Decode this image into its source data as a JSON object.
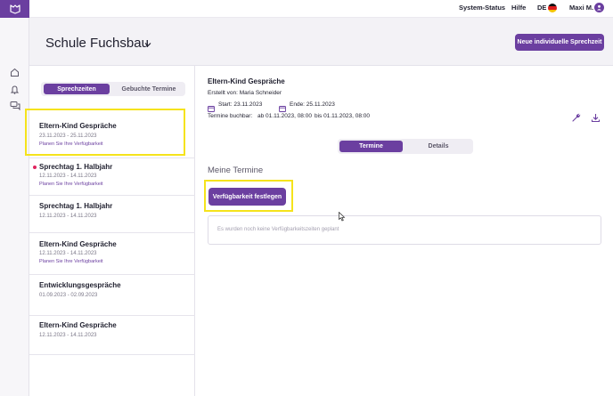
{
  "topbar": {
    "system_status": "System-Status",
    "help": "Hilfe",
    "language": "DE",
    "user": "Maxi M."
  },
  "header": {
    "title": "Schule Fuchsbau",
    "new_button": "Neue individuelle Sprechzeit"
  },
  "sidebar_tabs": {
    "active": "Sprechzeiten",
    "inactive": "Gebuchte Termine"
  },
  "list": [
    {
      "title": "Eltern-Kind Gespräche",
      "date": "23.11.2023 - 25.11.2023",
      "sub": "Planen Sie Ihre Verfügbarkeit"
    },
    {
      "title": "Sprechtag 1. Halbjahr",
      "date": "12.11.2023 - 14.11.2023",
      "sub": "Planen Sie Ihre Verfügbarkeit"
    },
    {
      "title": "Sprechtag 1. Halbjahr",
      "date": "12.11.2023 - 14.11.2023"
    },
    {
      "title": "Eltern-Kind Gespräche",
      "date": "12.11.2023 - 14.11.2023",
      "sub": "Planen Sie Ihre Verfügbarkeit"
    },
    {
      "title": "Entwicklungsgespräche",
      "date": "01.09.2023 - 02.09.2023"
    },
    {
      "title": "Eltern-Kind Gespräche",
      "date": "12.11.2023 - 14.11.2023"
    }
  ],
  "detail": {
    "title": "Eltern-Kind Gespräche",
    "created_by": "Erstellt von: Maria Schneider",
    "start": "Start: 23.11.2023",
    "end": "Ende: 25.11.2023",
    "bookable_label": "Termine buchbar:",
    "bookable_from": "ab 01.11.2023, 08:00",
    "bookable_to": "bis 01.11.2023, 08:00",
    "tabs": {
      "active": "Termine",
      "inactive": "Details"
    },
    "section_heading": "Meine Termine",
    "availability_button": "Verfügbarkeit festlegen",
    "empty_message": "Es wurden noch keine Verfügbarkeitszeiten geplant"
  },
  "colors": {
    "accent": "#6b3fa0",
    "highlight": "#f5e31c",
    "notification_dot": "#e0245e"
  }
}
